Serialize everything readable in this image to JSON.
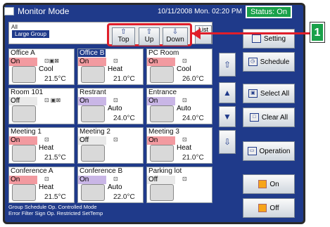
{
  "header": {
    "title": "Monitor Mode",
    "datetime": "10/11/2008 Mon. 02:20 PM",
    "status": "Status: On"
  },
  "group": {
    "all": "All",
    "large": "Large Group"
  },
  "nav": {
    "top": "Top",
    "up": "Up",
    "down": "Down",
    "list": "List",
    "arrow_up": "⇧",
    "arrow_down": "⇩"
  },
  "callout": {
    "number": "1"
  },
  "cells": [
    {
      "name": "Office A",
      "state": "On",
      "mode": "Cool",
      "temp": "21.5°C",
      "color": "#f29aa0"
    },
    {
      "name": "Office B",
      "state": "On",
      "mode": "Heat",
      "temp": "21.0°C",
      "color": "#f29aa0"
    },
    {
      "name": "PC Room",
      "state": "On",
      "mode": "Cool",
      "temp": "26.0°C",
      "color": "#f29aa0"
    },
    {
      "name": "Room 101",
      "state": "Off",
      "mode": "",
      "temp": "",
      "color": "#e9e9e9"
    },
    {
      "name": "Restrant",
      "state": "On",
      "mode": "Auto",
      "temp": "24.0°C",
      "color": "#c9b6e6"
    },
    {
      "name": "Entrance",
      "state": "On",
      "mode": "Auto",
      "temp": "24.0°C",
      "color": "#c9b6e6"
    },
    {
      "name": "Meeting 1",
      "state": "On",
      "mode": "Heat",
      "temp": "21.5°C",
      "color": "#f29aa0"
    },
    {
      "name": "Meeting 2",
      "state": "Off",
      "mode": "",
      "temp": "",
      "color": "#e9e9e9"
    },
    {
      "name": "Meeting 3",
      "state": "On",
      "mode": "Heat",
      "temp": "21.0°C",
      "color": "#f29aa0"
    },
    {
      "name": "Conference A",
      "state": "On",
      "mode": "Heat",
      "temp": "21.5°C",
      "color": "#f29aa0"
    },
    {
      "name": "Conference B",
      "state": "On",
      "mode": "Auto",
      "temp": "22.0°C",
      "color": "#c9b6e6"
    },
    {
      "name": "Parking lot",
      "state": "Off",
      "mode": "",
      "temp": "",
      "color": "#e9e9e9"
    }
  ],
  "side": {
    "setting": "Setting",
    "schedule": "Schedule",
    "select_all": "Select All",
    "clear_all": "Clear All",
    "operation": "Operation",
    "on": "On",
    "off": "Off"
  },
  "legend": {
    "line1": "Group  Schedule  Op. Controlled  Mode",
    "line2": "Error  Filter Sign  Op. Restricted  SetTemp"
  }
}
